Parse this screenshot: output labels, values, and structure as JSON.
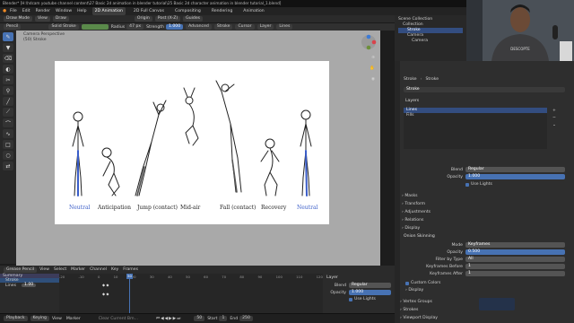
{
  "window_title": "Blender* [H:\\hdcam youtube channel content\\27 Basic 2d animation in blender tutorial\\25 Basic 2d  character animation in blender tutorial_1.blend]",
  "menu": [
    "File",
    "Edit",
    "Render",
    "Window",
    "Help"
  ],
  "workspaces": [
    "2D Animation",
    "2D Full Canvas",
    "Compositing",
    "Rendering",
    "Animation"
  ],
  "active_workspace": "2D Animation",
  "header": {
    "mode": "Draw Mode",
    "view": "View",
    "draw": "Draw",
    "origin": "Origin",
    "lock": "Post (X-Z)",
    "guides": "Guides"
  },
  "tool_header": {
    "tool": "Pencil",
    "stroke": "Solid Stroke",
    "radius_label": "Radius",
    "radius_value": "47 px",
    "strength_label": "Strength",
    "strength_value": "1.000",
    "advanced": "Advanced",
    "stroke2": "Stroke",
    "cursor": "Cursor",
    "layer": "Layer",
    "lines": "Lines"
  },
  "viewport_info": {
    "line1": "Camera Perspective",
    "line2": "(50) Stroke"
  },
  "poses": [
    "Neutral",
    "Anticipation",
    "Jump (contact)",
    "Mid-air",
    "Fall (contact)",
    "Recovery",
    "Neutral"
  ],
  "timeline": {
    "menu": [
      "Grease Pencil",
      "View",
      "Select",
      "Marker",
      "Channel",
      "Key",
      "Frames"
    ],
    "channels": [
      "Summary",
      "Stroke",
      "Lines"
    ],
    "lines_value": "1.00",
    "frames": [
      "-20",
      "-10",
      "0",
      "10",
      "20",
      "30",
      "40",
      "50",
      "60",
      "70",
      "80",
      "90",
      "100",
      "110",
      "120"
    ],
    "current_frame": "50"
  },
  "layer_panel": {
    "title": "Layer",
    "blend_label": "Blend",
    "blend_value": "Regular",
    "opacity_label": "Opacity",
    "opacity_value": "1.000",
    "use_lights": "Use Lights"
  },
  "status": {
    "playback": "Playback",
    "keying": "Keying",
    "view": "View",
    "marker": "Marker",
    "hint": "Clear Current Bm...",
    "frame": "50",
    "start_label": "Start",
    "start": "1",
    "end_label": "End",
    "end": "250"
  },
  "outliner": {
    "title": "Scene Collection",
    "items": [
      "Collection",
      "Stroke",
      "Camera",
      "Camera"
    ]
  },
  "properties": {
    "object": "Stroke",
    "data": "Stroke",
    "datablock": "Stroke",
    "layers_title": "Layers",
    "layers": [
      "Lines",
      "Fills"
    ],
    "blend_label": "Blend",
    "blend_value": "Regular",
    "opacity_label": "Opacity",
    "opacity_value": "1.000",
    "use_lights": "Use Lights",
    "sections": [
      "Masks",
      "Transform",
      "Adjustments",
      "Relations",
      "Display"
    ],
    "onion_title": "Onion Skinning",
    "mode_label": "Mode",
    "mode_value": "Keyframes",
    "opacity2_label": "Opacity",
    "opacity2_value": "0.500",
    "filter_label": "Filter by Type",
    "filter_value": "All",
    "before_label": "Keyframes Before",
    "before_value": "1",
    "after_label": "Keyframes After",
    "after_value": "1",
    "custom_colors": "Custom Colors",
    "display": "Display",
    "bottom_sections": [
      "Vertex Groups",
      "Strokes",
      "Viewport Display"
    ]
  },
  "webcam_shirt_text": "DESCOPTE"
}
